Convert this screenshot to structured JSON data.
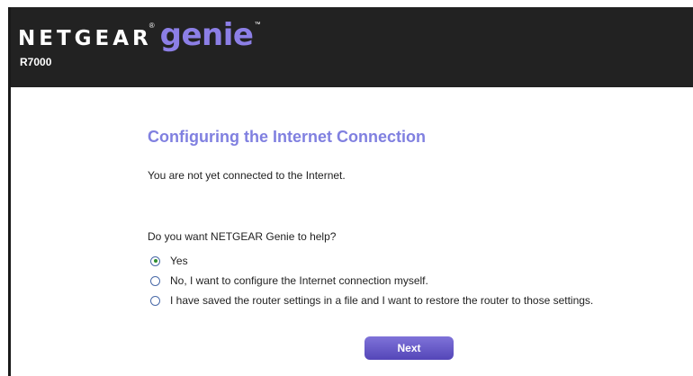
{
  "header": {
    "brand_name": "NETGEAR",
    "brand_reg": "®",
    "product_name": "genie",
    "product_tm": "™",
    "model": "R7000"
  },
  "main": {
    "title": "Configuring the Internet Connection",
    "status_text": "You are not yet connected to the Internet.",
    "question": "Do you want NETGEAR Genie to help?",
    "options": [
      {
        "label": "Yes",
        "selected": true
      },
      {
        "label": "No, I want to configure the Internet connection myself.",
        "selected": false
      },
      {
        "label": "I have saved the router settings in a file and I want to restore the router to those settings.",
        "selected": false
      }
    ],
    "next_label": "Next"
  },
  "colors": {
    "header_bg": "#222222",
    "accent": "#8080e0",
    "button": "#5f52c4",
    "radio_selected": "#2f8f2f"
  }
}
